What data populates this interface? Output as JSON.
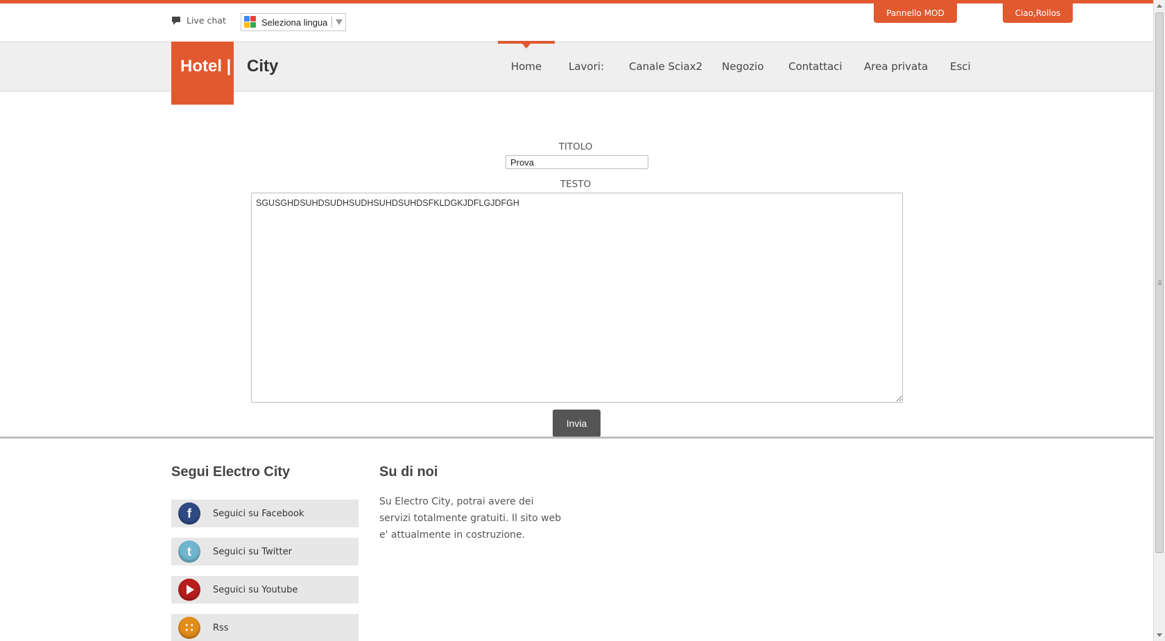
{
  "topbar": {
    "live_chat_label": "Live chat",
    "language_select_label": "Seleziona lingua",
    "mod_panel_label": "Pannello MOD",
    "user_greeting_label": "Ciao,Rollos"
  },
  "brand": {
    "part1": "Hotel |",
    "part2": "City",
    "accent_color": "#e2582f"
  },
  "nav": {
    "items": [
      {
        "label": "Home",
        "active": true
      },
      {
        "label": "Lavori:"
      },
      {
        "label": "Canale Sciax2"
      },
      {
        "label": "Negozio"
      },
      {
        "label": "Contattaci"
      },
      {
        "label": "Area privata"
      },
      {
        "label": "Esci"
      }
    ]
  },
  "form": {
    "title_label": "TITOLO",
    "title_value": "Prova",
    "text_label": "TESTO",
    "text_value": "SGUSGHDSUHDSUDHSUDHSUHDSUHDSFKLDGKJDFLGJDFGH",
    "submit_label": "Invia"
  },
  "footer": {
    "follow_heading": "Segui Electro City",
    "social": [
      {
        "label": "Seguici su Facebook",
        "icon": "facebook-icon"
      },
      {
        "label": "Seguici su Twitter",
        "icon": "twitter-icon"
      },
      {
        "label": "Seguici su Youtube",
        "icon": "youtube-icon"
      },
      {
        "label": "Rss",
        "icon": "rss-icon"
      }
    ],
    "about_heading": "Su di noi",
    "about_text": "Su Electro City, potrai avere dei servizi totalmente gratuiti. Il sito web e' attualmente in costruzione."
  }
}
